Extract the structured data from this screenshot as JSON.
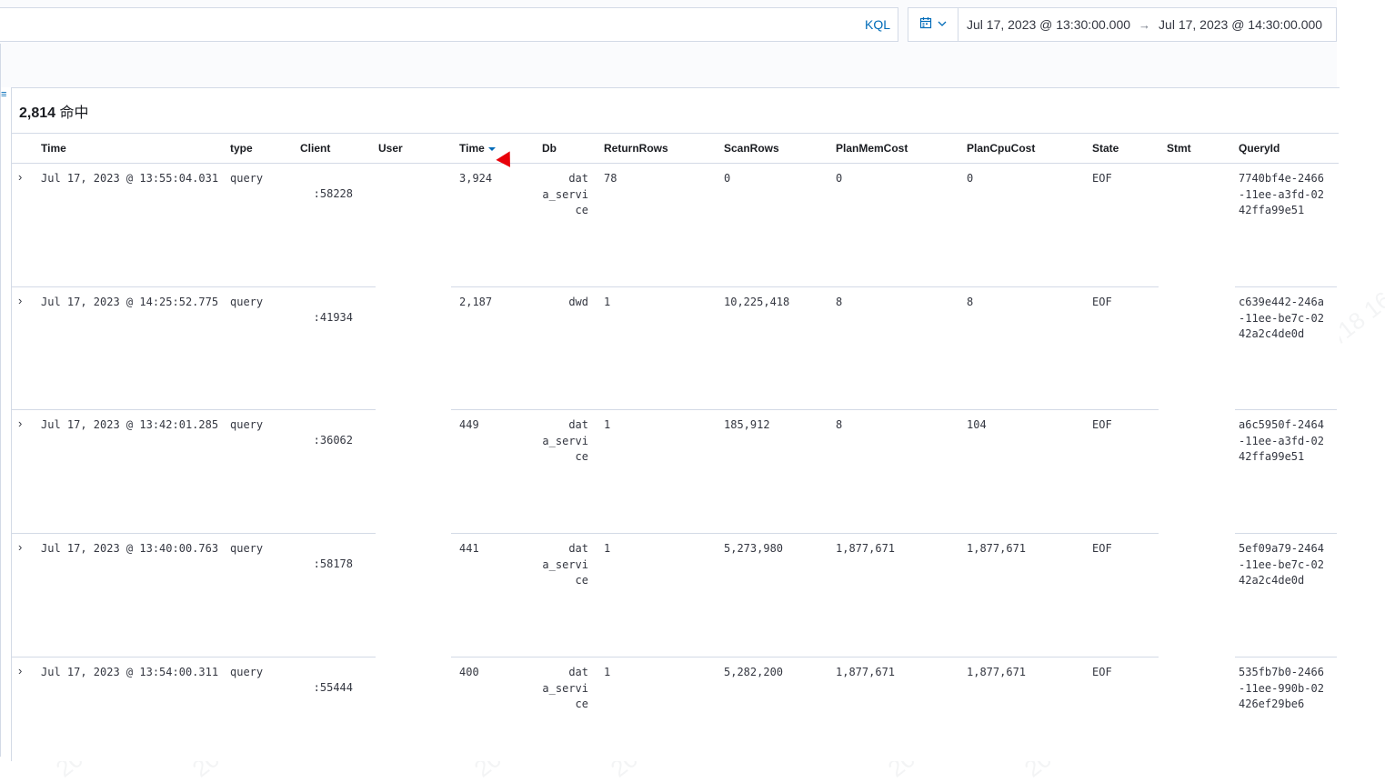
{
  "query_bar": {
    "language_label": "KQL"
  },
  "date_picker": {
    "start": "Jul 17, 2023 @ 13:30:00.000",
    "arrow": "→",
    "end": "Jul 17, 2023 @ 14:30:00.000"
  },
  "hits": {
    "count": "2,814",
    "label": "命中"
  },
  "columns": [
    "Time",
    "type",
    "Client",
    "User",
    "Time",
    "Db",
    "ReturnRows",
    "ScanRows",
    "PlanMemCost",
    "PlanCpuCost",
    "State",
    "Stmt",
    "QueryId"
  ],
  "rows": [
    {
      "time": "Jul 17, 2023 @ 13:55:04.031",
      "type": "query",
      "client": ":58228",
      "duration": "3,924",
      "db": "dat\na_servi\nce",
      "return_rows": "78",
      "scan_rows": "0",
      "plan_mem": "0",
      "plan_cpu": "0",
      "state": "EOF",
      "query_id": "7740bf4e-2466\n-11ee-a3fd-02\n42ffa99e51"
    },
    {
      "time": "Jul 17, 2023 @ 14:25:52.775",
      "type": "query",
      "client": ":41934",
      "duration": "2,187",
      "db": "dwd",
      "return_rows": "1",
      "scan_rows": "10,225,418",
      "plan_mem": "8",
      "plan_cpu": "8",
      "state": "EOF",
      "query_id": "c639e442-246a\n-11ee-be7c-02\n42a2c4de0d"
    },
    {
      "time": "Jul 17, 2023 @ 13:42:01.285",
      "type": "query",
      "client": ":36062",
      "duration": "449",
      "db": "dat\na_servi\nce",
      "return_rows": "1",
      "scan_rows": "185,912",
      "plan_mem": "8",
      "plan_cpu": "104",
      "state": "EOF",
      "query_id": "a6c5950f-2464\n-11ee-a3fd-02\n42ffa99e51"
    },
    {
      "time": "Jul 17, 2023 @ 13:40:00.763",
      "type": "query",
      "client": ":58178",
      "duration": "441",
      "db": "dat\na_servi\nce",
      "return_rows": "1",
      "scan_rows": "5,273,980",
      "plan_mem": "1,877,671",
      "plan_cpu": "1,877,671",
      "state": "EOF",
      "query_id": "5ef09a79-2464\n-11ee-be7c-02\n42a2c4de0d"
    },
    {
      "time": "Jul 17, 2023 @ 13:54:00.311",
      "type": "query",
      "client": ":55444",
      "duration": "400",
      "db": "dat\na_servi\nce",
      "return_rows": "1",
      "scan_rows": "5,282,200",
      "plan_mem": "1,877,671",
      "plan_cpu": "1,877,671",
      "state": "EOF",
      "query_id": "535fb7b0-2466\n-11ee-990b-02\n426ef29be6"
    }
  ],
  "icons": {
    "calendar": "calendar-icon",
    "chevron": "chevron-down-icon",
    "expand": "chevron-right-icon",
    "sort": "sort-down-icon",
    "menu": "menu-icon"
  },
  "colors": {
    "accent": "#006bb8",
    "border": "#d3dae6",
    "cursor": "#e8000a"
  }
}
